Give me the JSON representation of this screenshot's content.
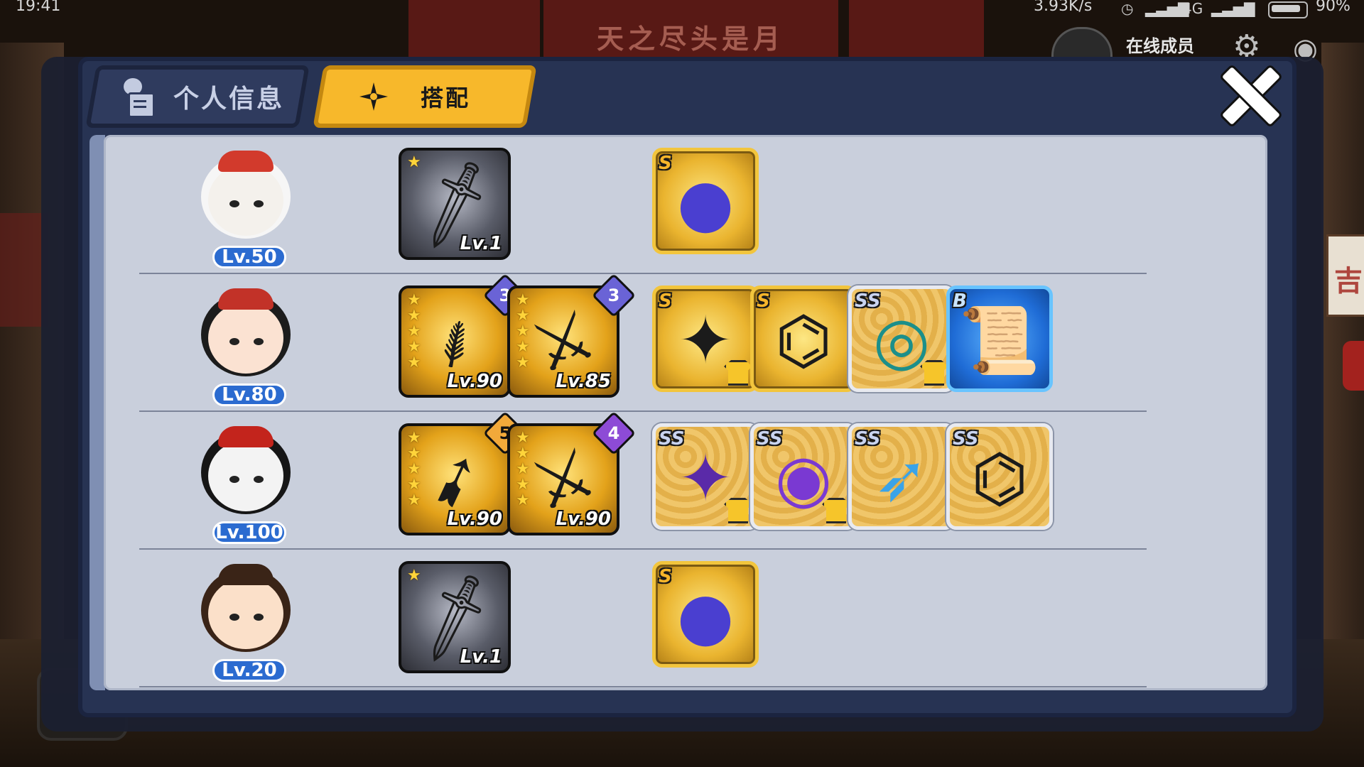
{
  "status_bar": {
    "time": "19:41",
    "net_speed": "3.93K/s",
    "network": "4G",
    "battery": "90%"
  },
  "background": {
    "banner_text": "天之尽头是月",
    "online_members": "在线成员"
  },
  "tabs": [
    {
      "label": "个人信息",
      "icon": "profile-card-icon",
      "active": false
    },
    {
      "label": "搭配",
      "icon": "shuriken-icon",
      "active": true
    }
  ],
  "close_icon": "close-icon",
  "colors": {
    "active_tab": "#f7b82b",
    "modal_bg": "#273353",
    "panel_bg": "#c9cfdc",
    "level_badge": "#2b6bd0"
  },
  "characters": [
    {
      "level": "Lv.50",
      "avatar": "panda-hood-ninja",
      "weapons": [
        {
          "stars": 1,
          "level": "Lv.1",
          "frame": "gray",
          "icon": "sword-icon"
        }
      ],
      "gear": [
        {
          "rank": "S",
          "frame": "gold",
          "icon": "purple-orb-icon"
        }
      ]
    },
    {
      "level": "Lv.80",
      "avatar": "antler-girl-ninja",
      "weapons": [
        {
          "stars": 5,
          "level": "Lv.90",
          "frame": "gold",
          "refine": "3",
          "icon": "scythe-icon"
        },
        {
          "stars": 5,
          "level": "Lv.85",
          "frame": "gold",
          "refine": "3",
          "icon": "katana-icon"
        }
      ],
      "gear": [
        {
          "rank": "S",
          "frame": "gold",
          "icon": "shuriken-icon",
          "shirt": true
        },
        {
          "rank": "S",
          "frame": "gold",
          "icon": "scroll-icon",
          "shirt": false
        },
        {
          "rank": "SS",
          "frame": "ss",
          "icon": "jade-ring-icon",
          "shirt": true
        },
        {
          "rank": "B",
          "frame": "blue",
          "icon": "parchment-icon",
          "shirt": false
        }
      ]
    },
    {
      "level": "Lv.100",
      "avatar": "fox-mask-ninja",
      "weapons": [
        {
          "stars": 5,
          "level": "Lv.90",
          "frame": "gold",
          "refine": "5",
          "icon": "ice-spear-icon"
        },
        {
          "stars": 5,
          "level": "Lv.90",
          "frame": "gold",
          "refine": "4",
          "icon": "dark-blade-icon"
        }
      ],
      "gear": [
        {
          "rank": "SS",
          "frame": "ss",
          "icon": "purple-shuriken-icon",
          "shirt": true
        },
        {
          "rank": "SS",
          "frame": "ss",
          "icon": "purple-ring-icon",
          "shirt": true
        },
        {
          "rank": "SS",
          "frame": "ss",
          "icon": "ice-kunai-icon",
          "shirt": false
        },
        {
          "rank": "SS",
          "frame": "ss",
          "icon": "scroll-icon",
          "shirt": false
        }
      ]
    },
    {
      "level": "Lv.20",
      "avatar": "bun-hair-girl-ninja",
      "weapons": [
        {
          "stars": 1,
          "level": "Lv.1",
          "frame": "gray",
          "icon": "short-blade-icon"
        }
      ],
      "gear": [
        {
          "rank": "S",
          "frame": "gold",
          "icon": "purple-orb-icon"
        }
      ]
    }
  ]
}
